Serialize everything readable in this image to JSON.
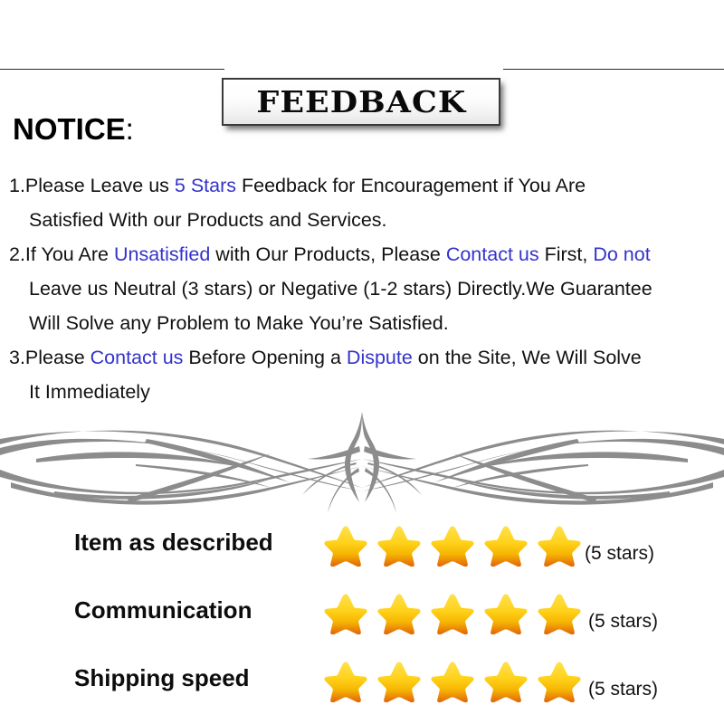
{
  "header": {
    "title": "FEEDBACK"
  },
  "notice": {
    "heading": "NOTICE",
    "heading_colon": ":",
    "lines": [
      {
        "segments": [
          {
            "text": "1.Please Leave us ",
            "color": "black"
          },
          {
            "text": " 5 Stars ",
            "color": "blue"
          },
          {
            "text": " Feedback for  Encouragement  if You Are",
            "color": "black"
          }
        ]
      },
      {
        "indent": true,
        "segments": [
          {
            "text": "Satisfied With our Products and Services.",
            "color": "black"
          }
        ]
      },
      {
        "segments": [
          {
            "text": "2.If You Are ",
            "color": "black"
          },
          {
            "text": "Unsatisfied",
            "color": "blue"
          },
          {
            "text": " with Our Products, Please ",
            "color": "black"
          },
          {
            "text": "Contact us",
            "color": "blue"
          },
          {
            "text": " First, ",
            "color": "black"
          },
          {
            "text": "Do not",
            "color": "blue"
          }
        ]
      },
      {
        "indent": true,
        "segments": [
          {
            "text": "Leave us Neutral (3 stars) or Negative (1-2 stars) Directly.We Guarantee",
            "color": "black"
          }
        ]
      },
      {
        "indent": true,
        "segments": [
          {
            "text": "Will Solve any Problem to Make You’re  Satisfied.",
            "color": "black"
          }
        ]
      },
      {
        "segments": [
          {
            "text": "3.Please ",
            "color": "black"
          },
          {
            "text": "Contact us",
            "color": "blue"
          },
          {
            "text": " Before Opening a ",
            "color": "black"
          },
          {
            "text": "Dispute",
            "color": "blue"
          },
          {
            "text": " on the Site, We Will Solve",
            "color": "black"
          }
        ]
      },
      {
        "indent": true,
        "segments": [
          {
            "text": "It Immediately",
            "color": "black"
          }
        ]
      }
    ]
  },
  "ornament": {
    "name": "decorative-pinstripe-flourish",
    "color": "#8c8c8c"
  },
  "ratings": {
    "star_count": 5,
    "rows": [
      {
        "label": "Item as described",
        "note": "(5 stars)",
        "stars": 5
      },
      {
        "label": "Communication",
        "note": "(5 stars)",
        "stars": 5
      },
      {
        "label": "Shipping speed",
        "note": "(5 stars)",
        "stars": 5
      }
    ]
  },
  "colors": {
    "link_blue": "#3333cc",
    "text_black": "#111111",
    "star_top": "#ffe14d",
    "star_mid": "#f5b301",
    "star_bottom": "#e2610a",
    "ornament_gray": "#8c8c8c"
  }
}
